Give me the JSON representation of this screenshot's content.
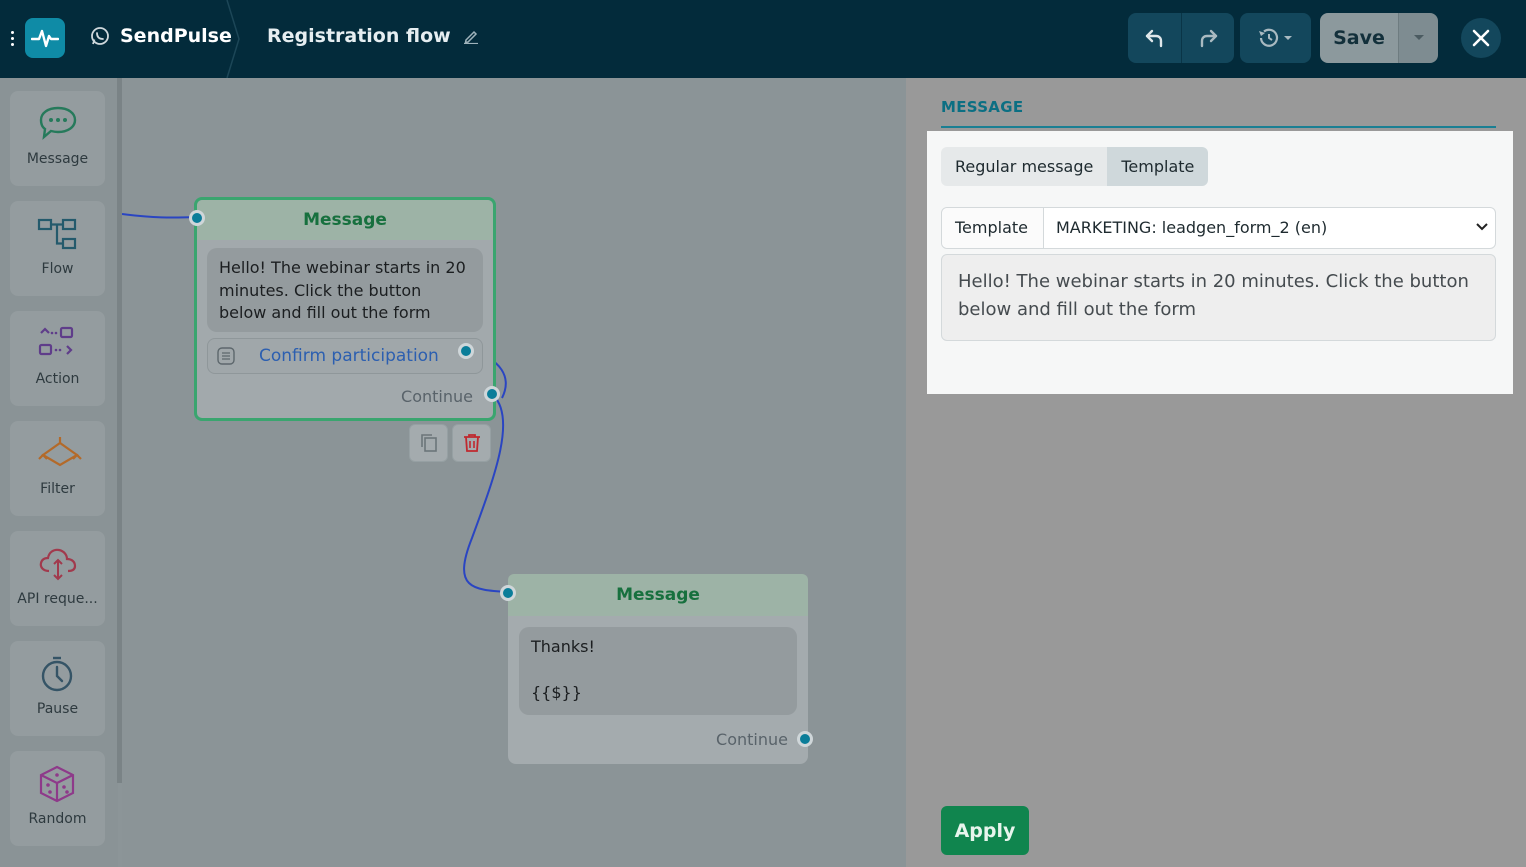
{
  "header": {
    "brand": "SendPulse",
    "flow_title": "Registration flow",
    "save_label": "Save"
  },
  "sidebar": {
    "items": [
      {
        "label": "Message",
        "icon": "message-bubble-icon"
      },
      {
        "label": "Flow",
        "icon": "flow-icon"
      },
      {
        "label": "Action",
        "icon": "action-icon"
      },
      {
        "label": "Filter",
        "icon": "filter-icon"
      },
      {
        "label": "API reque...",
        "icon": "api-cloud-icon"
      },
      {
        "label": "Pause",
        "icon": "clock-icon"
      },
      {
        "label": "Random",
        "icon": "dice-icon"
      }
    ]
  },
  "canvas": {
    "node1": {
      "title": "Message",
      "text": "Hello! The webinar starts in 20 minutes. Click the button below and fill out the form",
      "button": "Confirm participation",
      "continue": "Continue"
    },
    "node2": {
      "title": "Message",
      "line1": "Thanks!",
      "line2": "{{$}}",
      "continue": "Continue"
    }
  },
  "panel": {
    "title": "MESSAGE",
    "tabs": {
      "regular": "Regular message",
      "template": "Template"
    },
    "template_label": "Template",
    "template_value": "MARKETING: leadgen_form_2 (en)",
    "preview": "Hello! The webinar starts in 20 minutes. Click the button below and fill out the form",
    "apply_label": "Apply"
  },
  "colors": {
    "topbar": "#032b3b",
    "accent": "#0f8ba6",
    "apply": "#10854e",
    "node_title": "#17703e"
  }
}
